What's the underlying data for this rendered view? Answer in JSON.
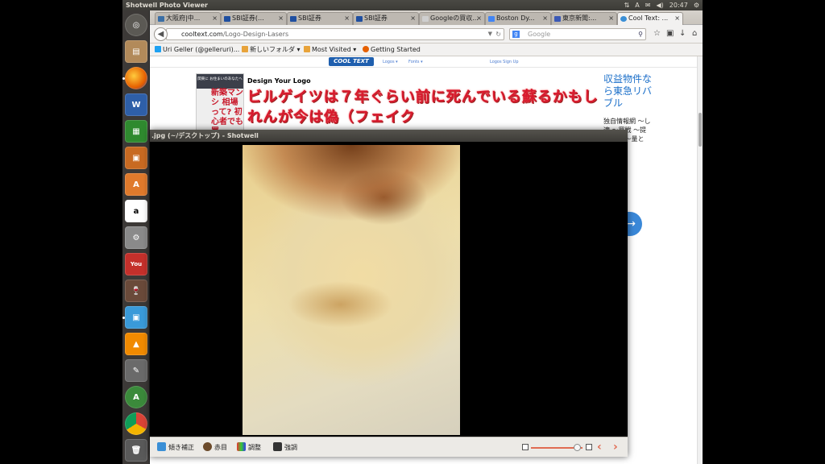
{
  "panel": {
    "app_title": "Shotwell Photo Viewer",
    "clock": "20:47",
    "keyboard_indicator": "A"
  },
  "browser": {
    "tabs": [
      {
        "label": "大阪府|中...",
        "icon": "globe-icon",
        "color": "#3a6ea5"
      },
      {
        "label": "SBI証券(...",
        "icon": "sbi-icon",
        "color": "#1f4fa0"
      },
      {
        "label": "SBI証券",
        "icon": "sbi-icon",
        "color": "#1f4fa0"
      },
      {
        "label": "SBI証券",
        "icon": "sbi-icon",
        "color": "#1f4fa0"
      },
      {
        "label": "Googleの買収...",
        "icon": "page-icon",
        "color": "#cfcfcf"
      },
      {
        "label": "Boston Dy...",
        "icon": "google-icon",
        "color": "#4285f4"
      },
      {
        "label": "東京新聞:...",
        "icon": "news-icon",
        "color": "#3b59b6"
      },
      {
        "label": "Cool Text: ...",
        "icon": "cooltext-icon",
        "color": "#3a8fd6"
      }
    ],
    "url_host": "cooltext.com",
    "url_path": "/Logo-Design-Lasers",
    "search_placeholder": "Google",
    "bookmarks": [
      {
        "label": "Uri Geller (@gelleruri)...",
        "icon": "twitter-icon",
        "color": "#1da1f2"
      },
      {
        "label": "新しいフォルダ",
        "icon": "folder-icon",
        "color": "#e8a33a"
      },
      {
        "label": "Most Visited",
        "icon": "folder-icon",
        "color": "#e8a33a"
      },
      {
        "label": "Getting Started",
        "icon": "firefox-icon",
        "color": "#e66000"
      }
    ]
  },
  "site": {
    "logo": "COOL TEXT",
    "nav": [
      "Logos ▾",
      "Fonts ▾",
      "Logos Sign Up"
    ],
    "design_title": "Design Your Logo",
    "laser_text": "ビルゲイツは７年ぐらい前に死んでいる蘇るかもしれんが今は偽（フェイク",
    "ad_left": {
      "top": "関東に お住まいのあなたへ",
      "red": "新築マンシ 相場って? 初心者でも買",
      "vertical": ""
    },
    "ad_right": {
      "headline": "収益物件なら東急リバブル",
      "body": "独自情報網 〜し適 〜買戦 〜提 〜倒的 〜量と 〜強み",
      "marker": "▷"
    }
  },
  "shotwell": {
    "title": ".jpg (~/デスクトップ) - Shotwell",
    "tools": [
      "傾き補正",
      "赤目",
      "調整",
      "強調"
    ],
    "zoom": 0.9
  }
}
